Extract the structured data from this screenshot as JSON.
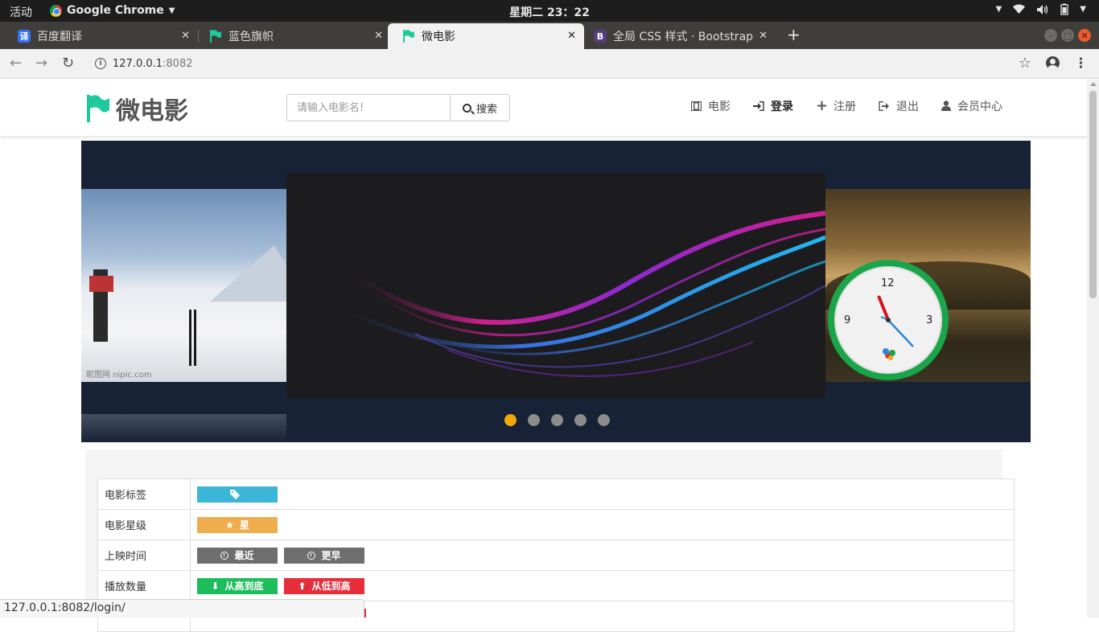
{
  "system_bar": {
    "activities": "活动",
    "app_name": "Google Chrome",
    "clock": "星期二 23：22"
  },
  "tabs": [
    {
      "title": "百度翻译",
      "favicon_text": "译",
      "favicon_color": "#3770f0"
    },
    {
      "title": "蓝色旗帜",
      "favicon_color": "#1ec99b"
    },
    {
      "title": "微电影",
      "favicon_color": "#1ec99b",
      "active": true
    },
    {
      "title": "全局 CSS 样式 · Bootstrap",
      "favicon_text": "B",
      "favicon_color": "#563d7c"
    }
  ],
  "address_bar": {
    "host": "127.0.0.1",
    "port": ":8082"
  },
  "site": {
    "brand": "微电影",
    "brand_color": "#1ec99b",
    "search_placeholder": "请输入电影名!",
    "search_button": "搜索",
    "menu": [
      {
        "label": "电影",
        "icon": "film-icon"
      },
      {
        "label": "登录",
        "icon": "login-icon"
      },
      {
        "label": "注册",
        "icon": "plus-icon"
      },
      {
        "label": "退出",
        "icon": "logout-icon"
      },
      {
        "label": "会员中心",
        "icon": "user-icon"
      }
    ]
  },
  "carousel": {
    "watermark": "昵图网 nipic.com",
    "dot_count": 5,
    "active_dot": 0,
    "active_dot_color": "#f4a90a",
    "clock_numbers": [
      "12",
      "3",
      "9"
    ]
  },
  "filters": {
    "rows": [
      {
        "label": "电影标签",
        "buttons": [
          {
            "label": "",
            "icon": "tag-icon",
            "color": "#3cb6d8"
          }
        ]
      },
      {
        "label": "电影星级",
        "buttons": [
          {
            "label": "星",
            "icon": "star-icon",
            "color": "#f0ad4e"
          }
        ]
      },
      {
        "label": "上映时间",
        "buttons": [
          {
            "label": "最近",
            "icon": "clock-icon",
            "color": "#6e6e6e"
          },
          {
            "label": "更早",
            "icon": "clock-icon",
            "color": "#6e6e6e"
          }
        ]
      },
      {
        "label": "播放数量",
        "buttons": [
          {
            "label": "从高到底",
            "icon": "arrow-down-icon",
            "color": "#1cbd5a"
          },
          {
            "label": "从低到高",
            "icon": "arrow-up-icon",
            "color": "#e52d3c"
          }
        ]
      }
    ]
  },
  "status_bar": {
    "url": "127.0.0.1:8082/login/"
  }
}
